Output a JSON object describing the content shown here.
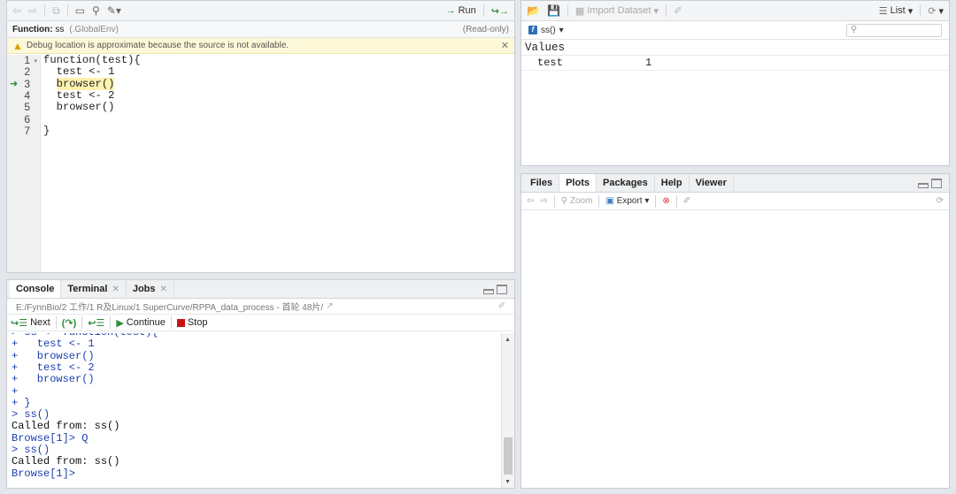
{
  "source": {
    "toolbar": {
      "run_label": "Run"
    },
    "function_bar": {
      "prefix": "Function:",
      "name": "ss",
      "env": "(.GlobalEnv)",
      "readonly": "(Read-only)"
    },
    "debug_warning": "Debug location is approximate because the source is not available.",
    "lines": [
      {
        "num": "1",
        "text": "function(test){"
      },
      {
        "num": "2",
        "text": "  test <- 1"
      },
      {
        "num": "3",
        "text": "  browser()"
      },
      {
        "num": "4",
        "text": "  test <- 2"
      },
      {
        "num": "5",
        "text": "  browser()"
      },
      {
        "num": "6",
        "text": ""
      },
      {
        "num": "7",
        "text": "}"
      }
    ],
    "current_line": 3
  },
  "console": {
    "tabs": [
      {
        "label": "Console"
      },
      {
        "label": "Terminal"
      },
      {
        "label": "Jobs"
      }
    ],
    "path": "E:/FynnBio/2 工作/1 R及Linux/1 SuperCurve/RPPA_data_process - 首轮 48片/",
    "debug_toolbar": {
      "next": "Next",
      "continue": "Continue",
      "stop": "Stop"
    },
    "lines": [
      {
        "text": "> ss <- function(test){",
        "kind": "input"
      },
      {
        "text": "+   test <- 1",
        "kind": "input"
      },
      {
        "text": "+   browser()",
        "kind": "input"
      },
      {
        "text": "+   test <- 2",
        "kind": "input"
      },
      {
        "text": "+   browser()",
        "kind": "input"
      },
      {
        "text": "+",
        "kind": "input"
      },
      {
        "text": "+ }",
        "kind": "input"
      },
      {
        "text": "> ss()",
        "kind": "input"
      },
      {
        "text": "Called from: ss()",
        "kind": "output"
      },
      {
        "text": "Browse[1]> Q",
        "kind": "input"
      },
      {
        "text": "> ss()",
        "kind": "input"
      },
      {
        "text": "Called from: ss()",
        "kind": "output"
      },
      {
        "text": "Browse[1]>",
        "kind": "input"
      }
    ]
  },
  "environment": {
    "toolbar": {
      "import_label": "Import Dataset",
      "view_label": "List"
    },
    "frame_label": "ss()",
    "search_placeholder": "",
    "section_title": "Values",
    "rows": [
      {
        "name": "test",
        "value": "1"
      }
    ]
  },
  "plots_pane": {
    "tabs": [
      {
        "label": "Files"
      },
      {
        "label": "Plots"
      },
      {
        "label": "Packages"
      },
      {
        "label": "Help"
      },
      {
        "label": "Viewer"
      }
    ],
    "toolbar": {
      "zoom_label": "Zoom",
      "export_label": "Export"
    }
  },
  "colors": {
    "input_text": "#1a3fae",
    "accent_green": "#2e8b3a",
    "highlight": "#fef2b0",
    "stop_red": "#cc1111"
  }
}
